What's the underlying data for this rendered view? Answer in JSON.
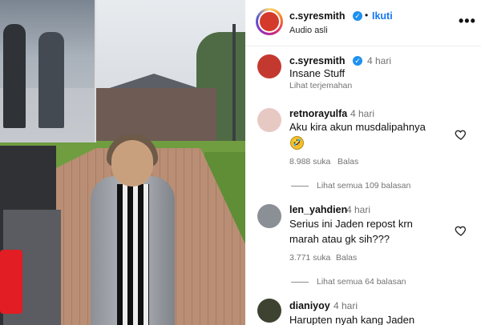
{
  "post": {
    "username": "c.syresmith",
    "follow_label": "Ikuti",
    "audio_label": "Audio asli",
    "more_label": "•••"
  },
  "caption": {
    "username": "c.syresmith",
    "time": "4 hari",
    "text": "Insane Stuff",
    "translate_label": "Lihat terjemahan"
  },
  "comments": [
    {
      "username": "retnorayulfa",
      "time": "4 hari",
      "text_line1": "Aku kira akun musdalipahnya",
      "emoji": "🤣",
      "likes": "8.988 suka",
      "reply_label": "Balas",
      "view_replies": "Lihat semua 109 balasan"
    },
    {
      "username": "len_yahdien",
      "time": "4 hari",
      "text_line1": "Serius ini Jaden repost krn",
      "text_line2": "marah atau gk sih???",
      "likes": "3.771 suka",
      "reply_label": "Balas",
      "view_replies": "Lihat semua 64 balasan"
    },
    {
      "username": "dianiyoy",
      "time": "4 hari",
      "text_line1": "Harupten nyah kang Jaden"
    }
  ],
  "icons": {
    "verified": "verified-badge-icon",
    "heart": "heart-outline-icon",
    "more": "more-horizontal-icon"
  },
  "colors": {
    "follow": "#1877f2",
    "verified": "#1e90f0",
    "muted": "#737373"
  }
}
